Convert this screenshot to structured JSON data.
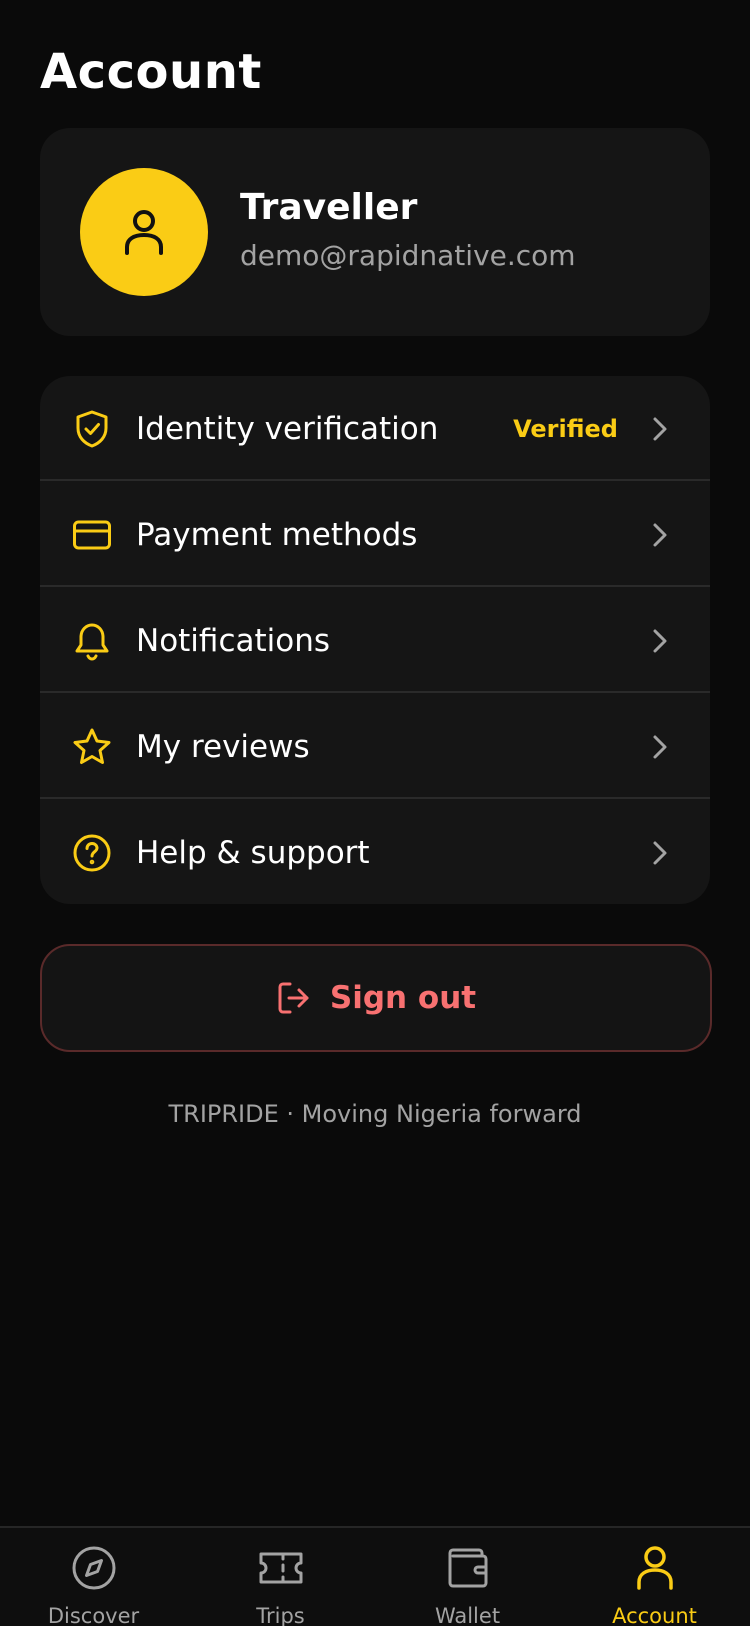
{
  "header": {
    "title": "Account"
  },
  "profile": {
    "name": "Traveller",
    "email": "demo@rapidnative.com",
    "avatar_icon": "user-icon"
  },
  "menu": {
    "items": [
      {
        "label": "Identity verification",
        "icon": "shield-check-icon",
        "badge": "Verified"
      },
      {
        "label": "Payment methods",
        "icon": "credit-card-icon",
        "badge": ""
      },
      {
        "label": "Notifications",
        "icon": "bell-icon",
        "badge": ""
      },
      {
        "label": "My reviews",
        "icon": "star-icon",
        "badge": ""
      },
      {
        "label": "Help & support",
        "icon": "help-circle-icon",
        "badge": ""
      }
    ]
  },
  "signout": {
    "label": "Sign out",
    "icon": "log-out-icon"
  },
  "footer": {
    "text": "TRIPRIDE · Moving Nigeria forward"
  },
  "tabs": [
    {
      "label": "Discover",
      "icon": "compass-icon",
      "active": false
    },
    {
      "label": "Trips",
      "icon": "ticket-icon",
      "active": false
    },
    {
      "label": "Wallet",
      "icon": "wallet-icon",
      "active": false
    },
    {
      "label": "Account",
      "icon": "user-icon",
      "active": true
    }
  ],
  "colors": {
    "background": "#0a0a0a",
    "card": "#151515",
    "accent": "#facc15",
    "danger": "#f87171",
    "muted": "#a3a3a3"
  }
}
